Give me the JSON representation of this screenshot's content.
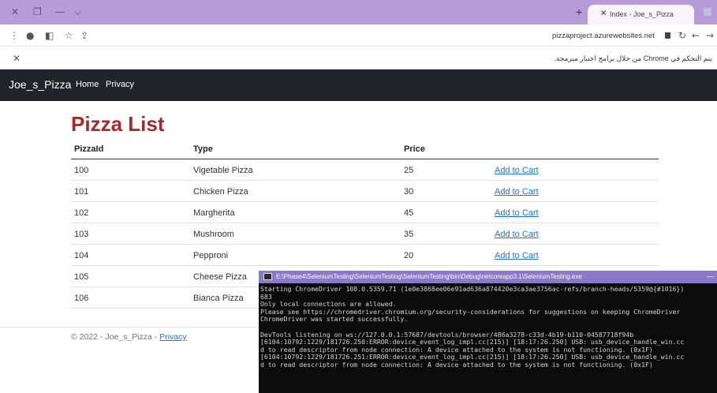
{
  "browser": {
    "tab_title": "Index - Joe_s_Pizza",
    "url": "pizzaproject.azurewebsites.net",
    "automation_notice": "يتم التحكم في Chrome من خلال برامج اختبار مبرمجة."
  },
  "navbar": {
    "brand": "Joe_s_Pizza",
    "links": [
      "Home",
      "Privacy"
    ]
  },
  "page": {
    "title": "Pizza List",
    "columns": [
      "PizzaId",
      "Type",
      "Price"
    ],
    "rows": [
      {
        "id": "100",
        "type": "Vigetable Pizza",
        "price": "25",
        "action": "Add to Cart"
      },
      {
        "id": "101",
        "type": "Chicken Pizza",
        "price": "30",
        "action": "Add to Cart"
      },
      {
        "id": "102",
        "type": "Margherita",
        "price": "45",
        "action": "Add to Cart"
      },
      {
        "id": "103",
        "type": "Mushroom",
        "price": "35",
        "action": "Add to Cart"
      },
      {
        "id": "104",
        "type": "Pepproni",
        "price": "20",
        "action": "Add to Cart"
      },
      {
        "id": "105",
        "type": "Cheese Pizza",
        "price": "",
        "action": ""
      },
      {
        "id": "106",
        "type": "Bianca Pizza",
        "price": "",
        "action": ""
      }
    ]
  },
  "footer": {
    "copyright": "© 2022 - Joe_s_Pizza - ",
    "privacy": "Privacy"
  },
  "console": {
    "title": "E:\\Phase4\\SeleniumTesting\\SeleniumTesting\\SeleniumTesting\\bin\\Debug\\netcoreapp3.1\\SeleniumTesting.exe",
    "lines": [
      "Starting ChromeDriver 108.0.5359.71 (1e0e3868ee06e91ad636a874420e3ca3ae3756ac-refs/branch-heads/5359@{#1016})",
      "683",
      "Only local connections are allowed.",
      "Please see https://chromedriver.chromium.org/security-considerations for suggestions on keeping ChromeDriver",
      "ChromeDriver was started successfully.",
      "",
      "DevTools listening on ws://127.0.0.1:57687/devtools/browser/486a3278-c33d-4b19-b110-04587718f94b",
      "[6104:10792:1229/181726.250:ERROR:device_event_log_impl.cc(215)] [18:17:26.250] USB: usb_device_handle_win.cc",
      "d to read descriptor from node connection: A device attached to the system is not functioning. (0x1F)",
      "[6104:10792:1229/181726.251:ERROR:device_event_log_impl.cc(215)] [18:17:26.250] USB: usb_device_handle_win.cc",
      "d to read descriptor from node connection: A device attached to the system is not functioning. (0x1F)"
    ]
  },
  "colors": {
    "titlebar": "#b59bd8",
    "navbar": "#212529",
    "title": "#a52a2a",
    "link": "#1a73e8"
  }
}
